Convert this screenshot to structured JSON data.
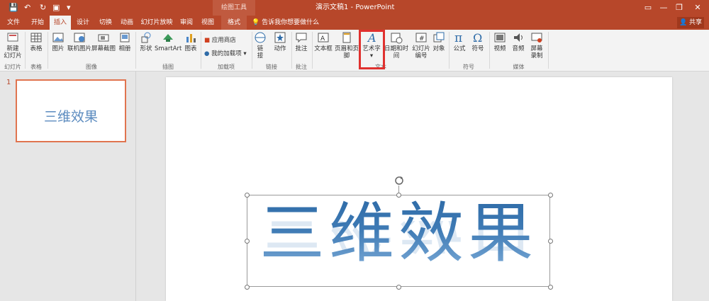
{
  "titlebar": {
    "drawing_tools": "绘图工具",
    "doc_title": "演示文稿1 - PowerPoint",
    "win_min": "—",
    "win_restore": "❐",
    "win_close": "✕"
  },
  "tabs": {
    "file": "文件",
    "home": "开始",
    "insert": "插入",
    "design": "设计",
    "transitions": "切换",
    "animations": "动画",
    "slideshow": "幻灯片放映",
    "review": "审阅",
    "view": "视图",
    "format": "格式",
    "tellme": "告诉我你想要做什么",
    "share": "共享"
  },
  "ribbon": {
    "new_slide_1": "新建",
    "new_slide_2": "幻灯片",
    "table": "表格",
    "picture": "图片",
    "online_picture": "联机图片",
    "screenshot": "屏幕截图",
    "album": "相册",
    "shapes": "形状",
    "smartart": "SmartArt",
    "chart": "图表",
    "store": "应用商店",
    "my_addins": "我的加载项",
    "link_1": "链",
    "link_2": "接",
    "action": "动作",
    "comment": "批注",
    "textbox": "文本框",
    "header_footer": "页眉和页脚",
    "wordart": "艺术字",
    "datetime": "日期和时间",
    "slide_number_1": "幻灯片",
    "slide_number_2": "编号",
    "object": "对象",
    "equation": "公式",
    "symbol": "符号",
    "video": "视频",
    "audio": "音频",
    "screen_rec_1": "屏幕",
    "screen_rec_2": "录制",
    "groups": {
      "slides": "幻灯片",
      "tables": "表格",
      "images": "图像",
      "illustrations": "插图",
      "addins": "加载项",
      "links": "链接",
      "comments": "批注",
      "text": "文本",
      "symbols": "符号",
      "media": "媒体"
    }
  },
  "slide_panel": {
    "number": "1",
    "thumb_text": "三维效果"
  },
  "slide": {
    "wordart_text": "三维效果"
  },
  "colors": {
    "accent": "#b7472a",
    "wordart_blue": "#3f7bb5",
    "highlight_red": "#e0312f"
  }
}
